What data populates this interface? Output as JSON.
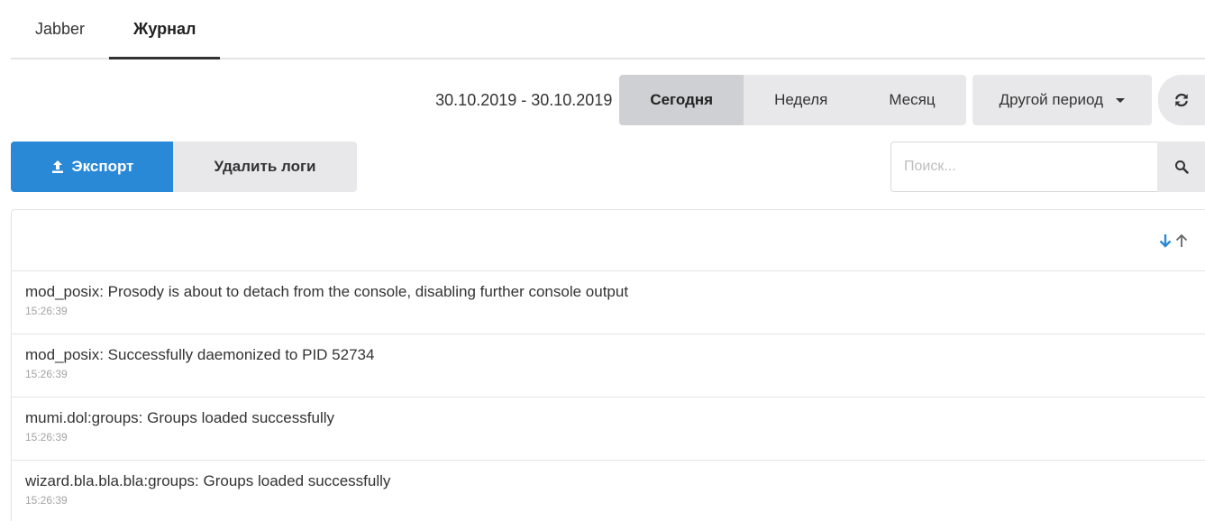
{
  "tabs": [
    {
      "label": "Jabber",
      "active": false
    },
    {
      "label": "Журнал",
      "active": true
    }
  ],
  "period": {
    "date_range": "30.10.2019 - 30.10.2019",
    "today": "Сегодня",
    "week": "Неделя",
    "month": "Месяц",
    "other": "Другой период",
    "active": "today"
  },
  "actions": {
    "export_label": "Экспорт",
    "delete_label": "Удалить логи"
  },
  "search": {
    "placeholder": "Поиск...",
    "value": ""
  },
  "icons": {
    "refresh": "refresh-icon",
    "upload": "upload-icon",
    "search": "search-icon",
    "sort_desc": "arrow-down-icon",
    "sort_asc": "arrow-up-icon"
  },
  "colors": {
    "primary": "#2a89d6",
    "button_bg": "#e8e8ea",
    "button_active": "#cfd0d3"
  },
  "logs": [
    {
      "message": "mod_posix: Prosody is about to detach from the console, disabling further console output",
      "time": "15:26:39"
    },
    {
      "message": "mod_posix: Successfully daemonized to PID 52734",
      "time": "15:26:39"
    },
    {
      "message": "mumi.dol:groups: Groups loaded successfully",
      "time": "15:26:39"
    },
    {
      "message": "wizard.bla.bla.bla:groups: Groups loaded successfully",
      "time": "15:26:39"
    }
  ]
}
